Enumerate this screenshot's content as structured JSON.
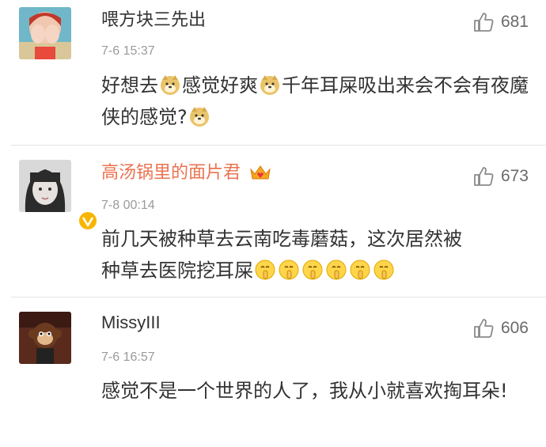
{
  "comments": [
    {
      "username": "喂方块三先出",
      "time": "7-6 15:37",
      "likes": "681",
      "text_parts": [
        "好想去",
        "感觉好爽",
        "千年耳屎吸出来会不会有夜魔侠的感觉?"
      ],
      "emoji": "doge-face-icon"
    },
    {
      "username": "高汤锅里的面片君",
      "time": "7-8 00:14",
      "likes": "673",
      "text_line1": "前几天被种草去云南吃毒蘑菇，这次居然被",
      "text_line2": "种草去医院挖耳屎",
      "emoji": "shush-face-icon",
      "badge": "crown-member-icon",
      "accent": "#eb7350"
    },
    {
      "username": "MissyIII",
      "time": "7-6 16:57",
      "likes": "606",
      "text": "感觉不是一个世界的人了，我从小就喜欢掏耳朵!"
    }
  ]
}
